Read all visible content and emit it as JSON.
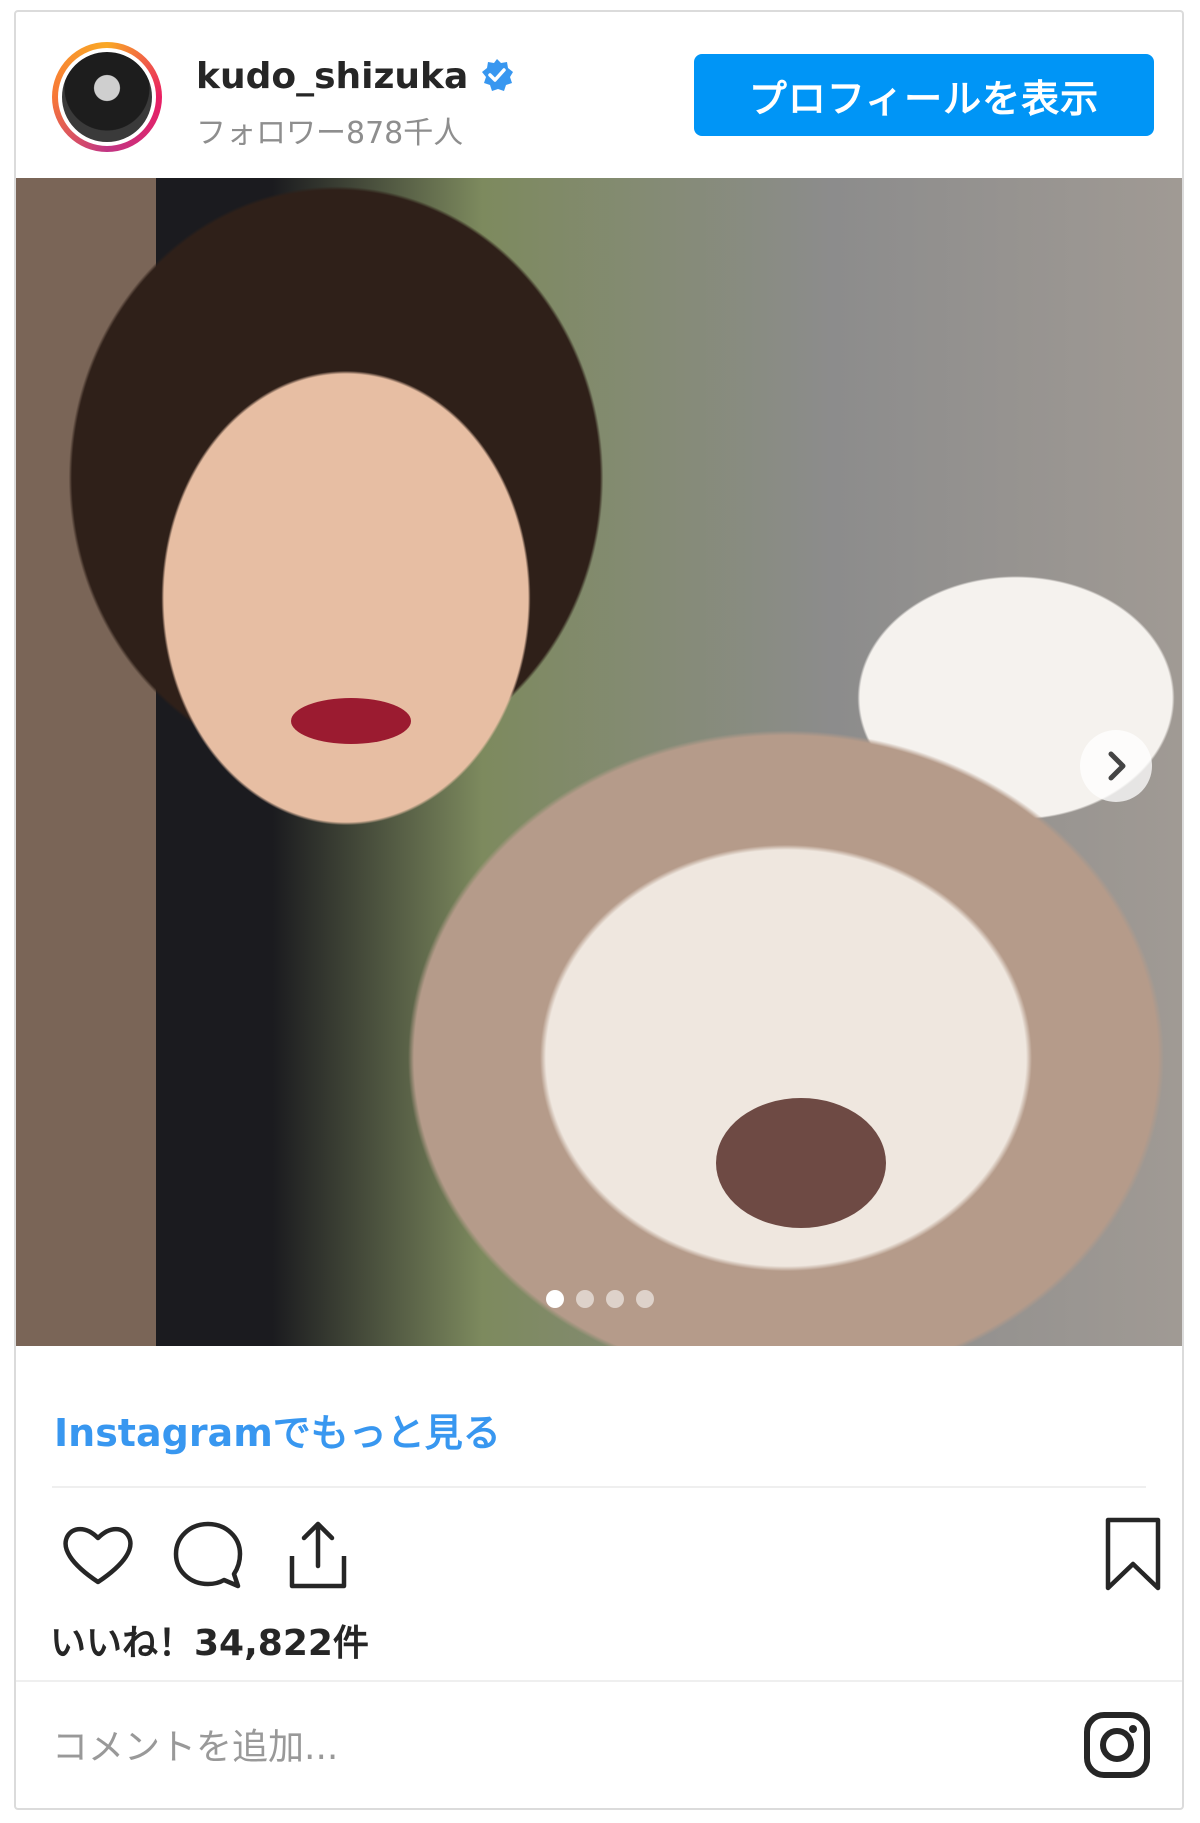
{
  "header": {
    "username": "kudo_shizuka",
    "followers": "フォロワー878千人",
    "profile_button": "プロフィールを表示",
    "verified_color": "#3897f0"
  },
  "post": {
    "carousel_dots": 4,
    "active_dot": 0
  },
  "more_link": "Instagramでもっと見る",
  "likes": "いいね！34,822件",
  "comment": {
    "placeholder": "コメントを追加..."
  },
  "colors": {
    "accent": "#0095f6",
    "link": "#3897f0",
    "text": "#262626",
    "muted": "#8e8e8e"
  },
  "icons": [
    "heart-icon",
    "comment-icon",
    "share-icon",
    "bookmark-icon",
    "instagram-icon",
    "verified-badge-icon",
    "chevron-right-icon"
  ]
}
